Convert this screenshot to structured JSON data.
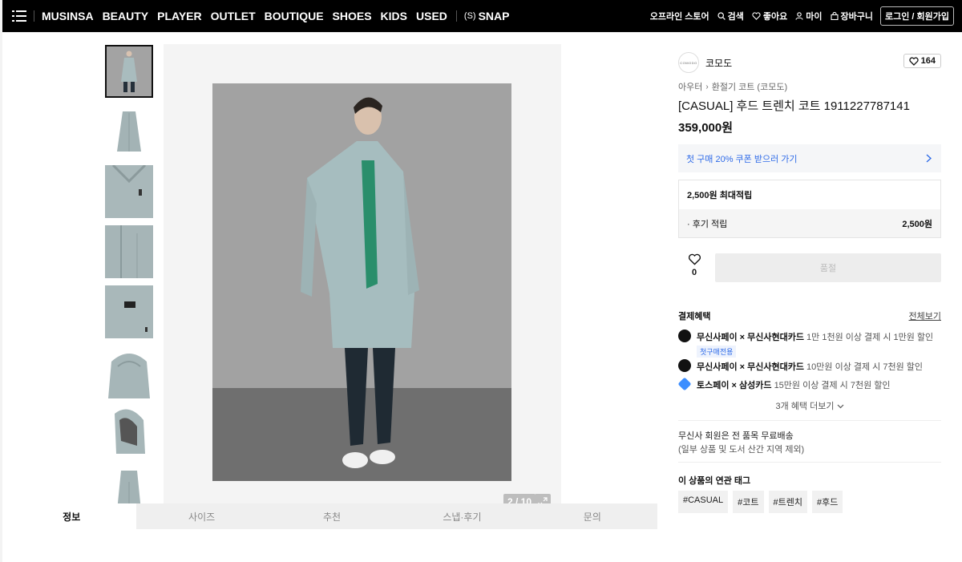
{
  "nav": {
    "links": [
      "MUSINSA",
      "BEAUTY",
      "PLAYER",
      "OUTLET",
      "BOUTIQUE",
      "SHOES",
      "KIDS",
      "USED"
    ],
    "snap_badge": "(S)",
    "snap_label": "SNAP",
    "offline_store": "오프라인 스토어",
    "search": "검색",
    "likes": "좋아요",
    "my": "마이",
    "cart": "장바구니",
    "login": "로그인 / 회원가입"
  },
  "gallery": {
    "counter": "2 / 10"
  },
  "tabs": [
    "정보",
    "사이즈",
    "추천",
    "스냅·후기",
    "문의"
  ],
  "product": {
    "brand_logo_text": "COMODO",
    "brand": "코모도",
    "like_count": "164",
    "category": "아우터",
    "subcategory": "환절기 코트 (코모도)",
    "title": "[CASUAL] 후드 트렌치 코트 1911227787141",
    "price": "359,000원",
    "coupon": "첫 구매 20% 쿠폰 받으러 가기",
    "reward_max": "2,500원 최대적립",
    "review_reward_label": "· 후기 적립",
    "review_reward_amount": "2,500원",
    "wish_count": "0",
    "soldout": "품절"
  },
  "benefits": {
    "title": "결제혜택",
    "view_all": "전체보기",
    "items": [
      {
        "brand": "무신사페이 × 무신사현대카드",
        "desc": "1만 1천원 이상 결제 시 1만원 할인",
        "badge": "첫구매전용"
      },
      {
        "brand": "무신사페이 × 무신사현대카드",
        "desc": "10만원 이상 결제 시 7천원 할인"
      },
      {
        "brand": "토스페이 × 삼성카드",
        "desc": "15만원 이상 결제 시 7천원 할인"
      }
    ],
    "more": "3개 혜택 더보기"
  },
  "shipping": {
    "line1": "무신사 회원은 전 품목 무료배송",
    "line2": "(일부 상품 및 도서 산간 지역 제외)"
  },
  "tags": {
    "title": "이 상품의 연관 태그",
    "items": [
      "#CASUAL",
      "#코트",
      "#트렌치",
      "#후드"
    ]
  }
}
